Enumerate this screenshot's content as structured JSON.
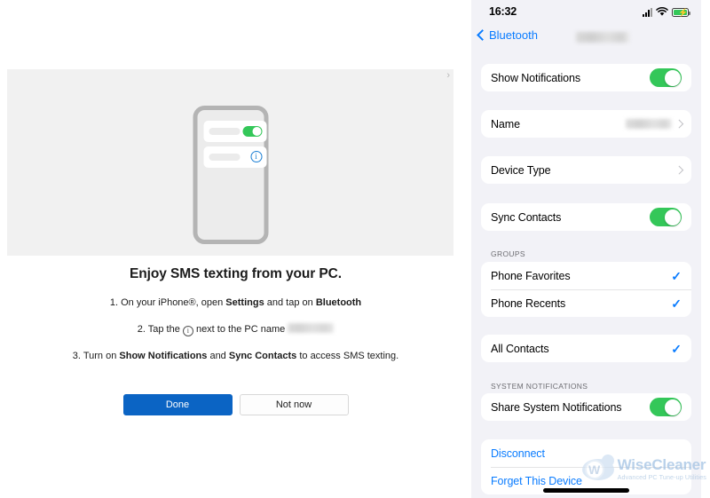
{
  "left_panel": {
    "hero": {
      "chevron_glyph": "›",
      "phone_illustration": {
        "toggle_state": "on",
        "info_glyph": "i"
      }
    },
    "headline": "Enjoy SMS texting from your PC.",
    "steps": [
      {
        "number": "1.",
        "prefix": "On your iPhone®, open ",
        "bold1": "Settings",
        "middle": " and tap on ",
        "bold2": "Bluetooth",
        "suffix": ""
      },
      {
        "number": "2.",
        "prefix": "Tap the ",
        "icon": "ⓘ",
        "middle": " next to the PC name ",
        "redacted": "",
        "suffix": ""
      },
      {
        "number": "3.",
        "prefix": "Turn on ",
        "bold1": "Show Notifications",
        "middle": " and ",
        "bold2": "Sync Contacts",
        "suffix": " to access SMS texting."
      }
    ],
    "buttons": {
      "primary_label": "Done",
      "secondary_label": "Not now"
    }
  },
  "phone_panel": {
    "status_bar": {
      "time": "16:32",
      "icons": [
        "cellular-signal-icon",
        "wifi-icon",
        "battery-charging-icon"
      ]
    },
    "nav": {
      "back_label": "Bluetooth",
      "title_redacted": ""
    },
    "sections": [
      {
        "header": "",
        "rows": [
          {
            "label": "Show Notifications",
            "control": "switch",
            "state": "on",
            "highlighted": true
          }
        ]
      },
      {
        "header": "",
        "rows": [
          {
            "label": "Name",
            "control": "value-chevron",
            "value_redacted": "",
            "highlighted": false
          }
        ]
      },
      {
        "header": "",
        "rows": [
          {
            "label": "Device Type",
            "control": "chevron",
            "highlighted": false
          }
        ]
      },
      {
        "header": "",
        "rows": [
          {
            "label": "Sync Contacts",
            "control": "switch",
            "state": "on",
            "highlighted": true
          }
        ]
      },
      {
        "header": "GROUPS",
        "rows": [
          {
            "label": "Phone Favorites",
            "control": "checkmark",
            "checked": true,
            "highlighted": false
          },
          {
            "label": "Phone Recents",
            "control": "checkmark",
            "checked": true,
            "highlighted": false
          }
        ]
      },
      {
        "header": "",
        "rows": [
          {
            "label": "All Contacts",
            "control": "checkmark",
            "checked": true,
            "highlighted": false
          }
        ]
      },
      {
        "header": "SYSTEM NOTIFICATIONS",
        "rows": [
          {
            "label": "Share System Notifications",
            "control": "switch",
            "state": "on",
            "highlighted": true
          }
        ]
      },
      {
        "header": "",
        "rows": [
          {
            "label": "Disconnect",
            "control": "link",
            "highlighted": false
          },
          {
            "label": "Forget This Device",
            "control": "link",
            "highlighted": false
          }
        ]
      }
    ]
  },
  "watermark": {
    "mark": "W",
    "name": "WiseCleaner",
    "tagline": "Advanced PC Tune-up Utilities"
  },
  "colors": {
    "ios_green": "#34C759",
    "ios_blue": "#0A7CFF",
    "windows_blue": "#0B64C4",
    "highlight_red": "#FF0000",
    "ios_group_bg": "#F2F2F7"
  }
}
